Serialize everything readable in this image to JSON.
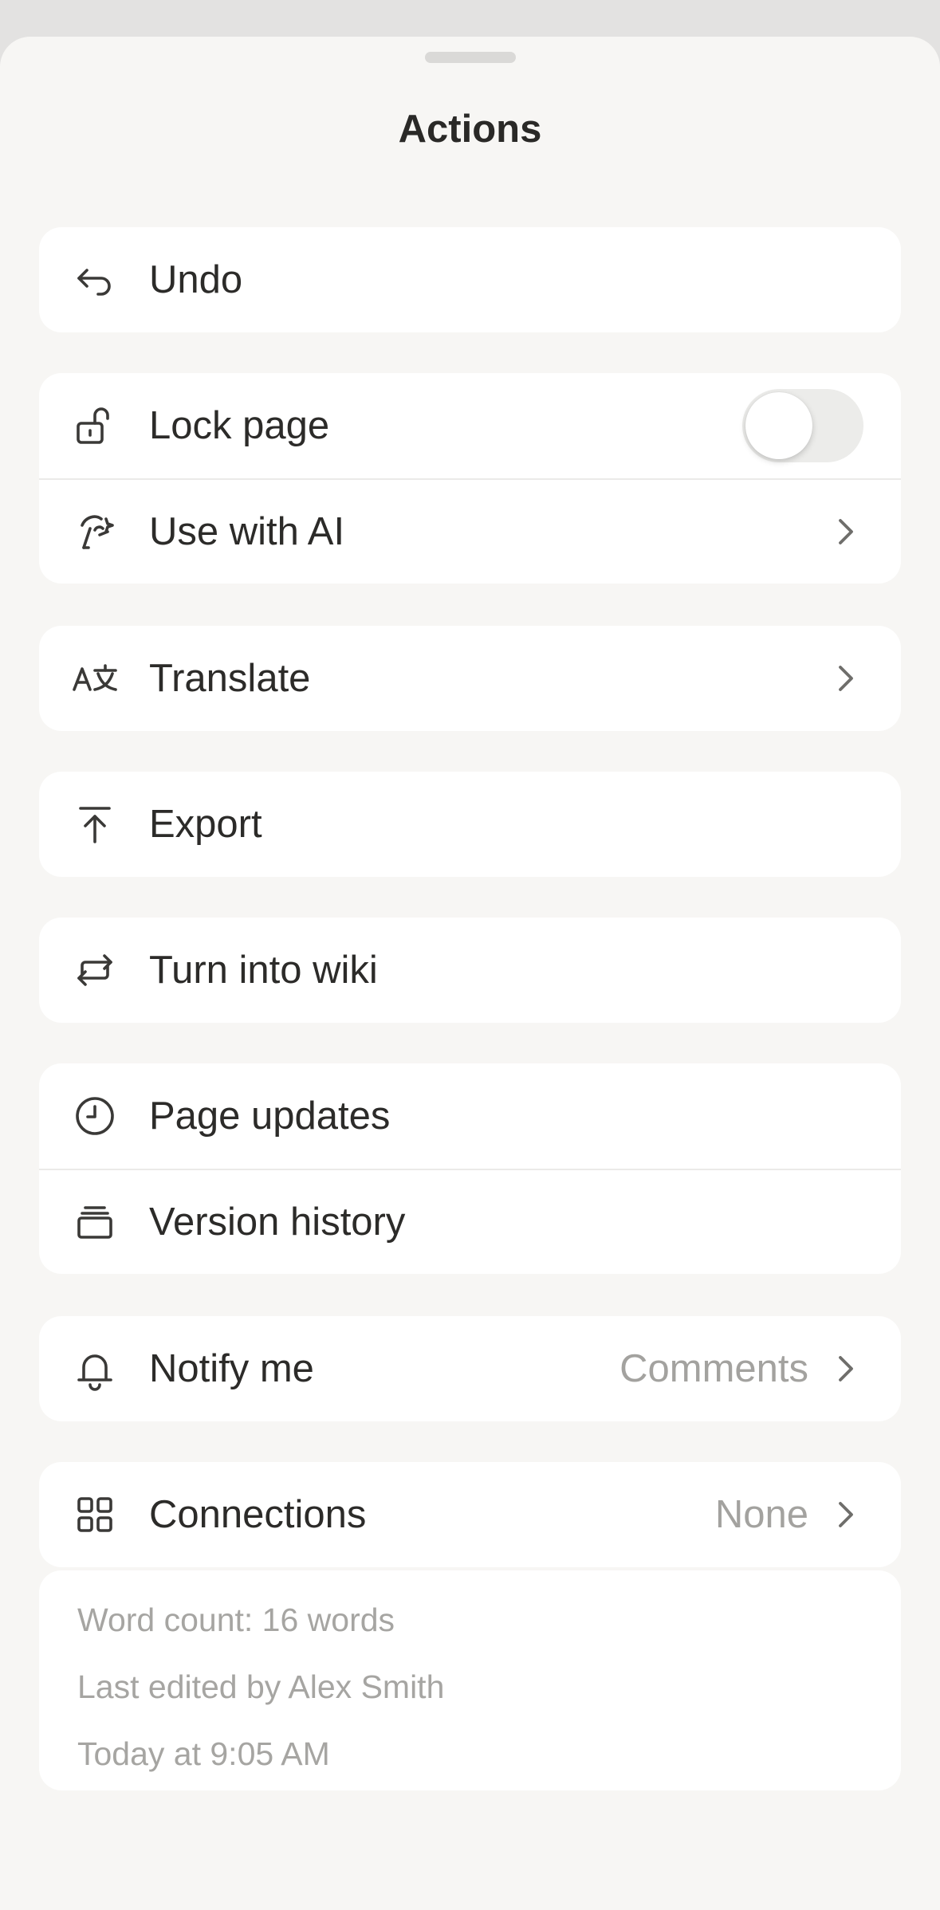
{
  "sheet": {
    "title": "Actions"
  },
  "groups": {
    "undo": {
      "label": "Undo"
    },
    "lock": {
      "label": "Lock page",
      "toggle_on": false
    },
    "ai": {
      "label": "Use with AI"
    },
    "translate": {
      "label": "Translate"
    },
    "export": {
      "label": "Export"
    },
    "wiki": {
      "label": "Turn into wiki"
    },
    "updates": {
      "label": "Page updates"
    },
    "history": {
      "label": "Version history"
    },
    "notify": {
      "label": "Notify me",
      "value": "Comments"
    },
    "connections": {
      "label": "Connections",
      "value": "None"
    }
  },
  "info": {
    "word_count": "Word count: 16 words",
    "last_edited_by": "Last edited by Alex Smith",
    "last_edited_time": "Today at 9:05 AM"
  },
  "icons": {
    "undo": "undo-arrow-icon",
    "lock": "unlocked-padlock-icon",
    "ai": "ai-face-icon",
    "translate": "translate-icon",
    "export": "export-arrow-up-icon",
    "wiki": "convert-arrows-icon",
    "updates": "clock-icon",
    "history": "version-stack-icon",
    "notify": "bell-icon",
    "connections": "grid-icon",
    "chevron": "chevron-right-icon"
  }
}
